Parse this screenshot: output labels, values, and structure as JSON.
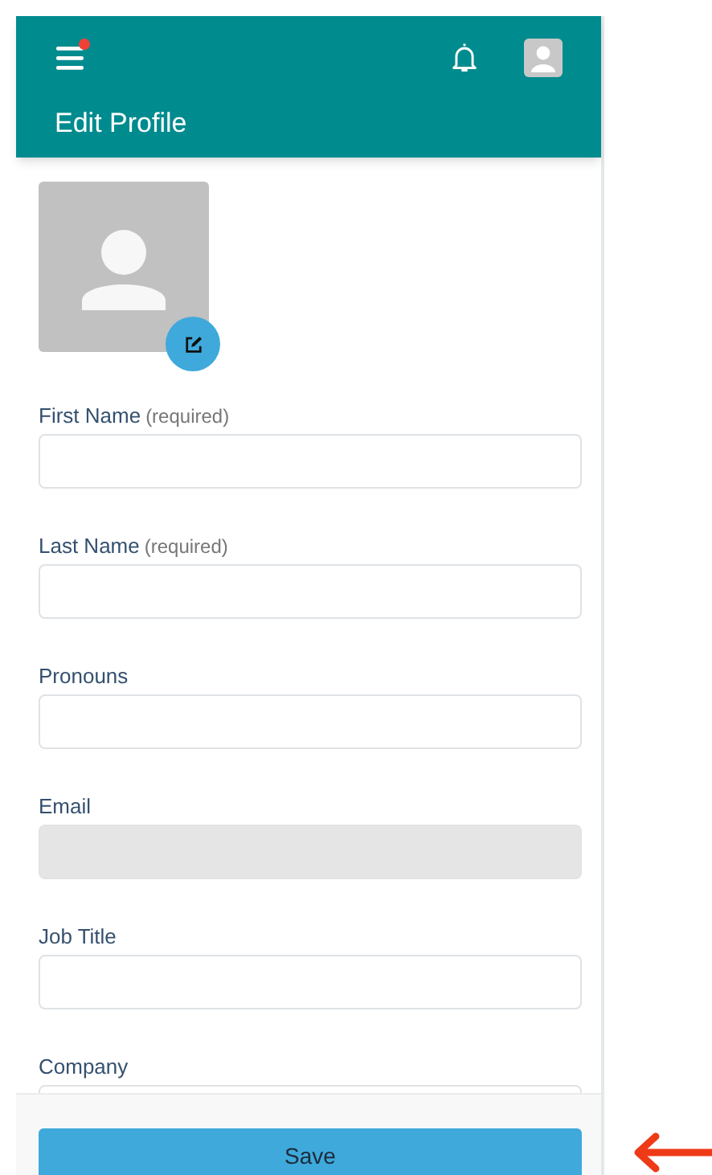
{
  "header": {
    "title": "Edit Profile",
    "menu_badge": true
  },
  "fields": [
    {
      "label": "First Name",
      "hint": "(required)",
      "disabled": false
    },
    {
      "label": "Last Name",
      "hint": "(required)",
      "disabled": false
    },
    {
      "label": "Pronouns",
      "disabled": false
    },
    {
      "label": "Email",
      "disabled": true
    },
    {
      "label": "Job Title",
      "disabled": false
    },
    {
      "label": "Company"
    }
  ],
  "save_button": "Save"
}
